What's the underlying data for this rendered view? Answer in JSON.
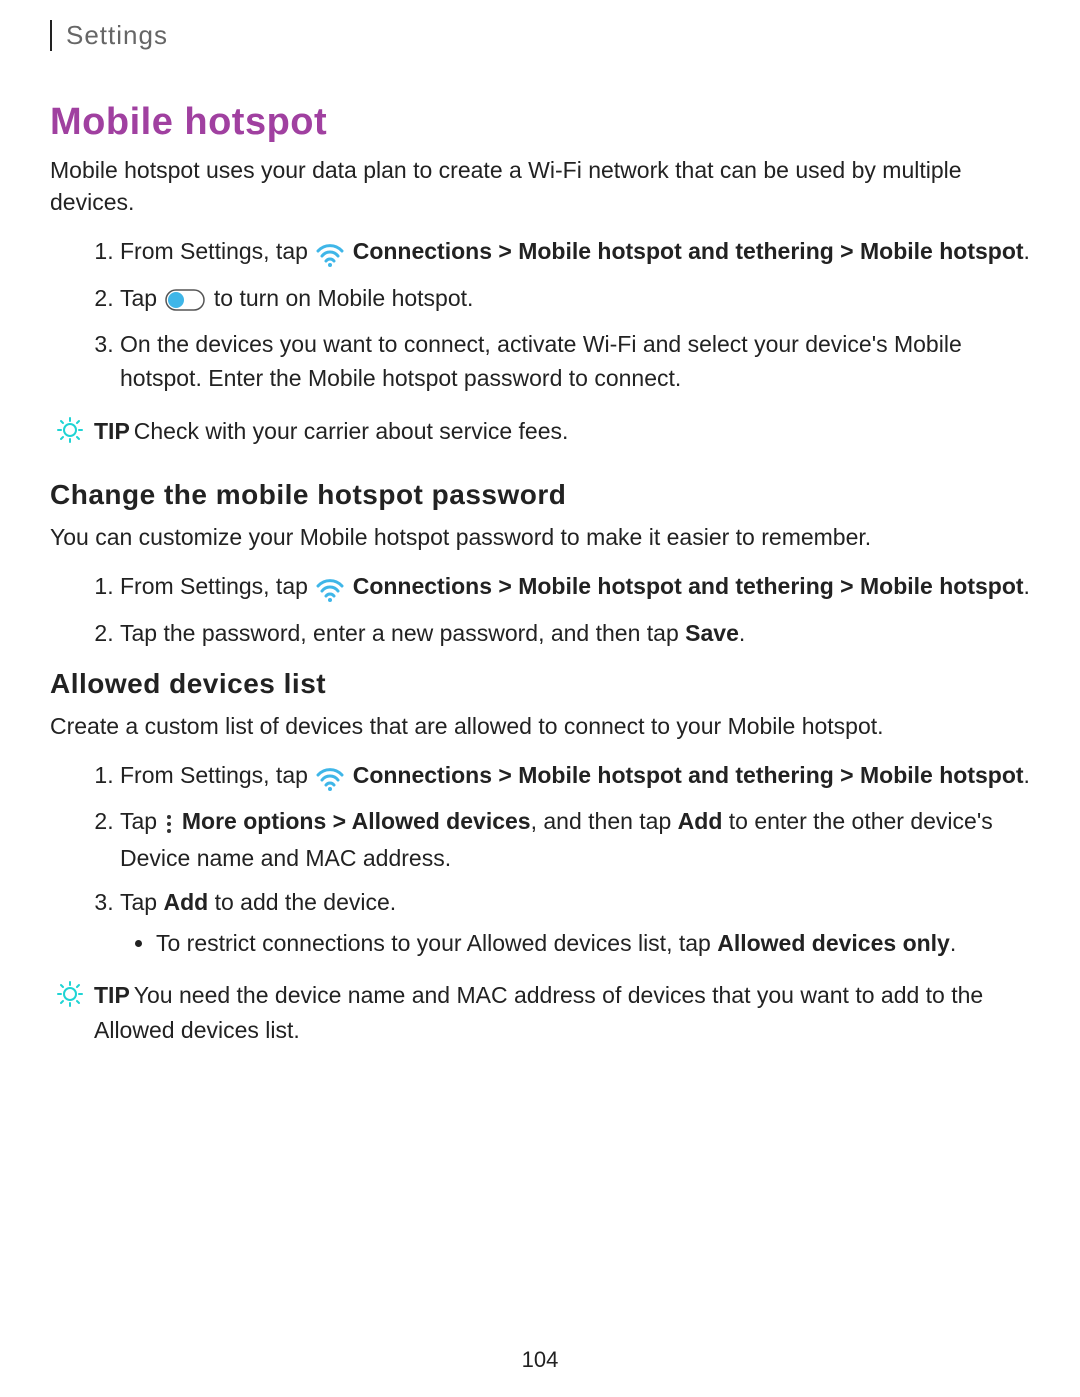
{
  "breadcrumb": "Settings",
  "h1": "Mobile hotspot",
  "intro": "Mobile hotspot uses your data plan to create a Wi-Fi network that can be used by multiple devices.",
  "nav": {
    "prefix": "From Settings, tap ",
    "path1": "Connections",
    "sep": " > ",
    "path2": "Mobile hotspot and tethering",
    "path3": "Mobile hotspot"
  },
  "steps1": {
    "s2a": "Tap ",
    "s2b": " to turn on Mobile hotspot.",
    "s3": "On the devices you want to connect, activate Wi-Fi and select your device's Mobile hotspot. Enter the Mobile hotspot password to connect."
  },
  "tip1": {
    "label": "TIP",
    "text": "Check with your carrier about service fees."
  },
  "h2_password": "Change the mobile hotspot password",
  "password_intro": "You can customize your Mobile hotspot password to make it easier to remember.",
  "steps2": {
    "s2a": "Tap the password, enter a new password, and then tap ",
    "s2b": "Save",
    "s2c": "."
  },
  "h2_allowed": "Allowed devices list",
  "allowed_intro": "Create a custom list of devices that are allowed to connect to your Mobile hotspot.",
  "steps3": {
    "s2a": "Tap ",
    "s2b": "More options",
    "s2c": "Allowed devices",
    "s2d": ", and then tap ",
    "s2e": "Add",
    "s2f": " to enter the other device's Device name and MAC address.",
    "s3a": "Tap ",
    "s3b": "Add",
    "s3c": " to add the device.",
    "bullet_a": "To restrict connections to your Allowed devices list, tap ",
    "bullet_b": "Allowed devices only",
    "bullet_c": "."
  },
  "tip2": {
    "label": "TIP",
    "text": "You need the device name and MAC address of devices that you want to add to the Allowed devices list."
  },
  "page_number": "104"
}
